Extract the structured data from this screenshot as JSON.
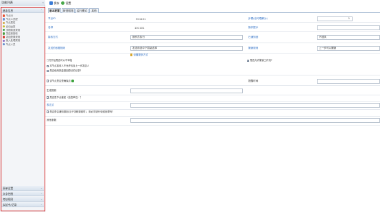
{
  "sidebar": {
    "title": "功能列表",
    "collapse_glyph": "«",
    "groups_top": [
      {
        "label": "基本信息",
        "arrow": "⌃"
      }
    ],
    "tree_items": [
      {
        "label": "节点ID",
        "color": "#e84f2e"
      },
      {
        "label": "节点人员配",
        "color": "#6a8fd0"
      },
      {
        "label": "节点属性",
        "color": "#d0a640"
      },
      {
        "label": "自动运算",
        "color": "#c9b92a"
      },
      {
        "label": "流程制造规则",
        "color": "#3ca04c"
      },
      {
        "label": "发送到接收",
        "color": "#4b9c3c"
      },
      {
        "label": "发送配置规则",
        "color": "#d23c2c"
      },
      {
        "label": "接入处理规则",
        "color": "#8b6bbf"
      },
      {
        "label": "节点人员",
        "color": "#5e88c8"
      }
    ],
    "groups_bottom": [
      {
        "label": "表单设置",
        "arrow": "⌄"
      },
      {
        "label": "文字控制",
        "arrow": "⌄"
      },
      {
        "label": "考核规则",
        "arrow": "⌄"
      },
      {
        "label": "实验中/记录",
        "arrow": "⌄"
      }
    ]
  },
  "toolbar": {
    "save_label": "保存",
    "settings_label": "设置",
    "save_color": "#3a7bd5",
    "settings_color": "#4aa84a"
  },
  "tabs": [
    {
      "label": "基本配置"
    },
    {
      "label": "按钮权限"
    },
    {
      "label": "运行模式"
    },
    {
      "label": "其他"
    }
  ],
  "form": {
    "node_id_label": "节点ID",
    "node_id_value": "301101",
    "step_label": "步骤(也可理解为)",
    "step_value": "1",
    "name_label": "名称",
    "name_value": "101101",
    "op_tip_label": "操作提示",
    "op_tip_value": "",
    "dept_label": "接收方式",
    "dept_value": "操作员执行",
    "confirm_label": "已通知回",
    "confirm_value": "不回执",
    "send_rule_label": "发送的依据规则",
    "send_rule_value": "发送前选中下层级选择",
    "back_label": "撤销规则",
    "back_value": "上一步可以撤销",
    "more_label": "设置更多方式",
    "checks": [
      {
        "label": "□打开后是否可以不审批",
        "checked": false
      },
      {
        "label": "是否允许撤销工作流?",
        "checked": true,
        "right": true
      },
      {
        "label": "本节点接收人不允许包含上一步发送人",
        "checked": true
      },
      {
        "label": "是否使用把量退回原记的记录?",
        "checked": true
      }
    ],
    "sub_check_label": "该节点是否是确保点",
    "sub_check_checked": false,
    "timeout_label": "超时时限",
    "reminder_label": "提醒时间",
    "reminder_value": "",
    "sub_label": "生成规则",
    "sub_value": "",
    "warn_check_label": "是否是节点催促（会签单位）？",
    "warn_check_checked": false,
    "remark_label": "表达式",
    "end_check_label": "是否是否通知退回(当子流程退回时)，则必须进行驳回处理吗?",
    "end_check_checked": false,
    "other_label": "其他参数",
    "other_value": ""
  }
}
